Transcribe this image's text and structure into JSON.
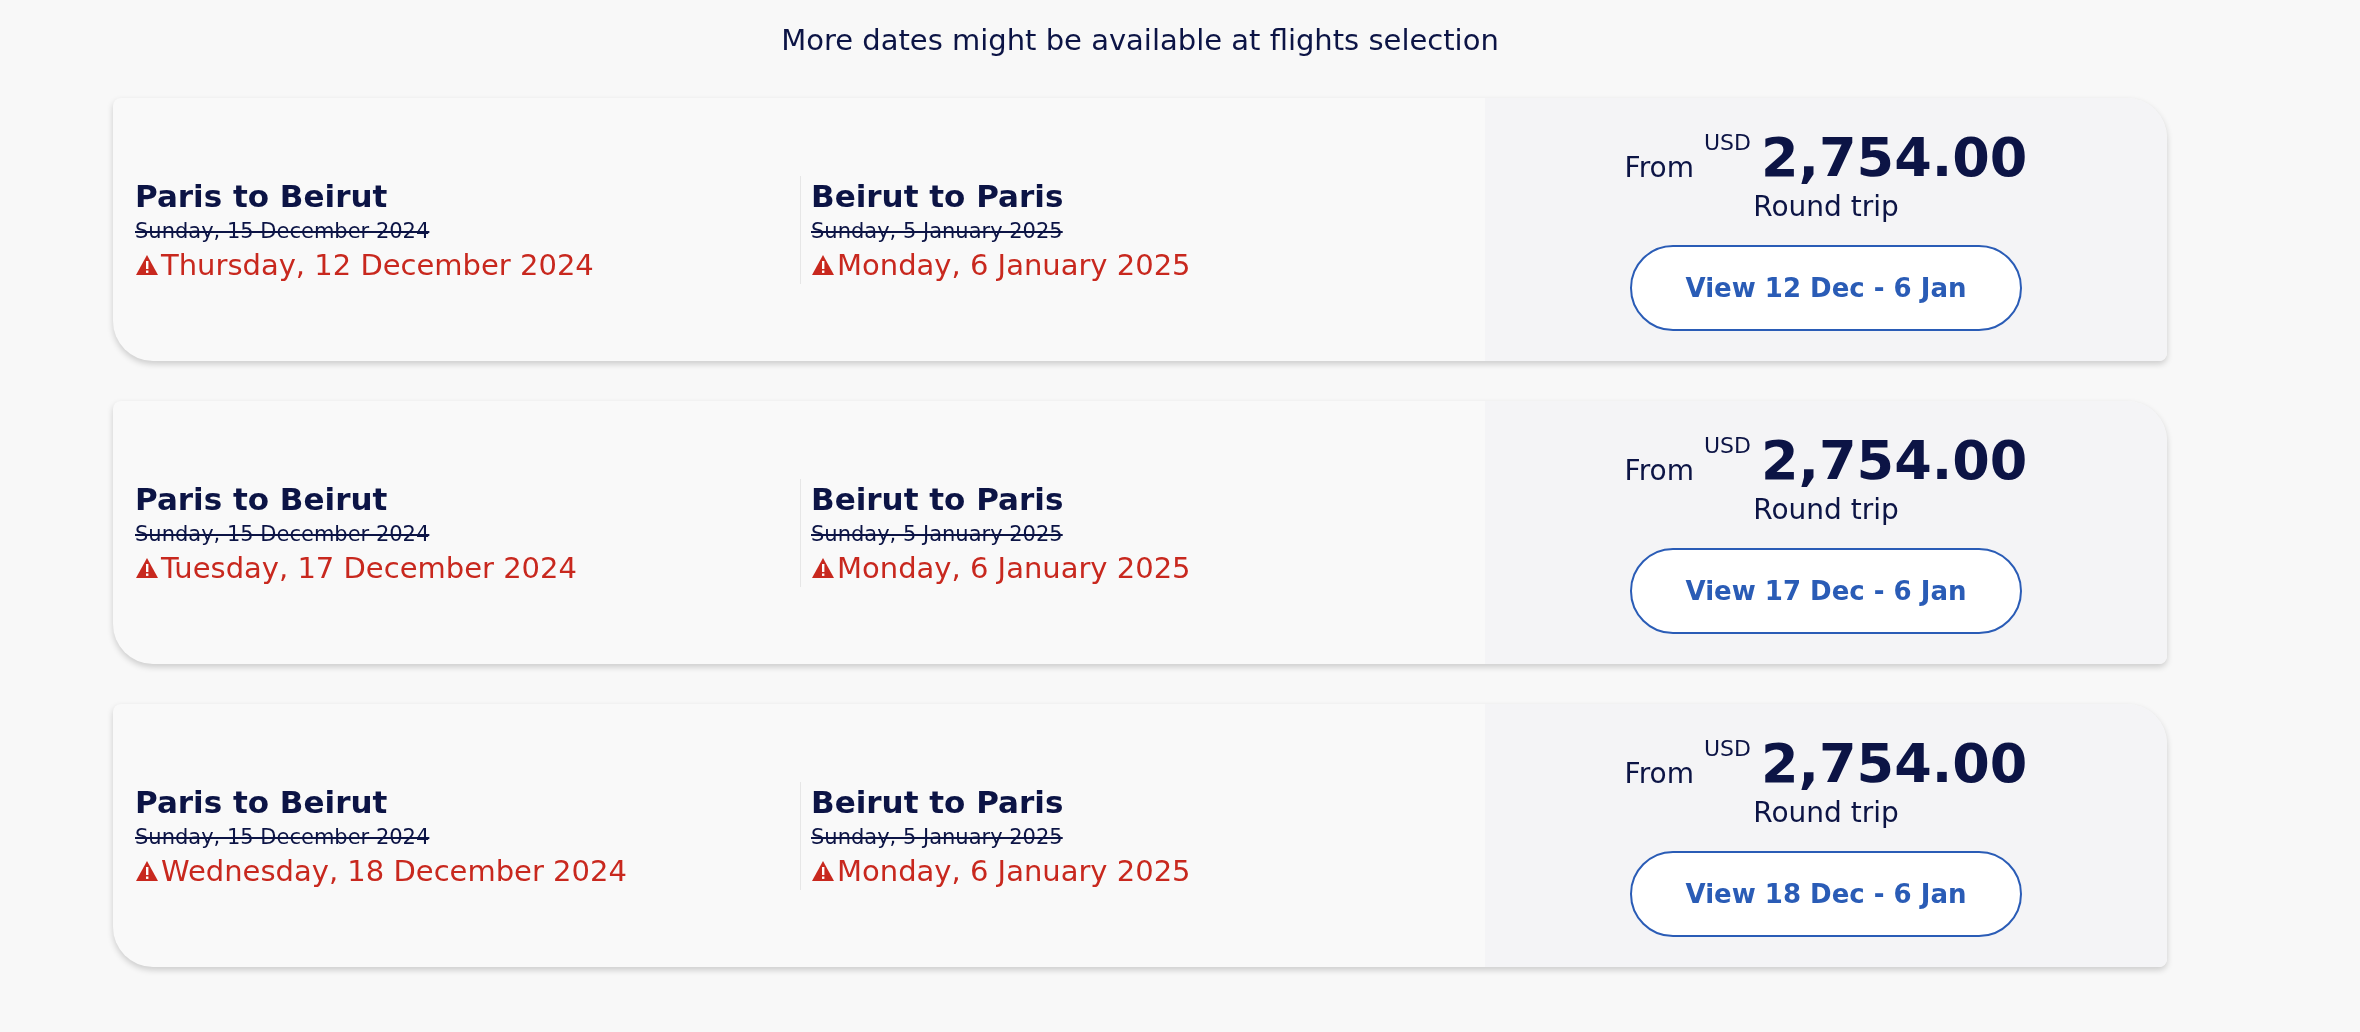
{
  "notice": "More dates might be available at flights selection",
  "results": [
    {
      "legs": [
        {
          "route": "Paris to Beirut",
          "original_date": "Sunday, 15 December 2024",
          "new_date": "Thursday, 12 December 2024"
        },
        {
          "route": "Beirut to Paris",
          "original_date": "Sunday, 5 January 2025",
          "new_date": "Monday, 6 January 2025"
        }
      ],
      "from_label": "From",
      "currency": "USD",
      "price": "2,754.00",
      "trip_type": "Round trip",
      "button": "View 12 Dec - 6 Jan"
    },
    {
      "legs": [
        {
          "route": "Paris to Beirut",
          "original_date": "Sunday, 15 December 2024",
          "new_date": "Tuesday, 17 December 2024"
        },
        {
          "route": "Beirut to Paris",
          "original_date": "Sunday, 5 January 2025",
          "new_date": "Monday, 6 January 2025"
        }
      ],
      "from_label": "From",
      "currency": "USD",
      "price": "2,754.00",
      "trip_type": "Round trip",
      "button": "View 17 Dec - 6 Jan"
    },
    {
      "legs": [
        {
          "route": "Paris to Beirut",
          "original_date": "Sunday, 15 December 2024",
          "new_date": "Wednesday, 18 December 2024"
        },
        {
          "route": "Beirut to Paris",
          "original_date": "Sunday, 5 January 2025",
          "new_date": "Monday, 6 January 2025"
        }
      ],
      "from_label": "From",
      "currency": "USD",
      "price": "2,754.00",
      "trip_type": "Round trip",
      "button": "View 18 Dec - 6 Jan"
    }
  ]
}
